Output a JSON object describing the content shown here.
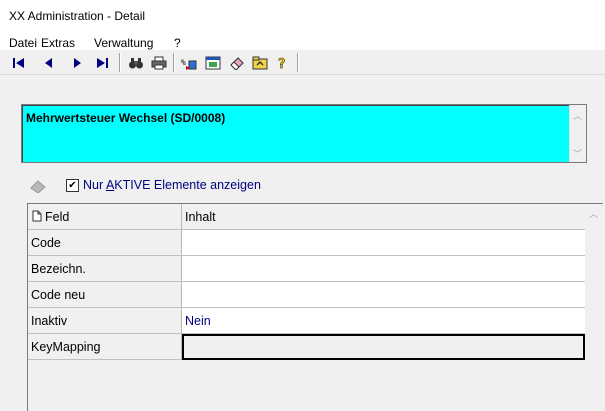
{
  "window": {
    "title": "XX Administration - Detail"
  },
  "menu": {
    "items": [
      "Datei",
      "Extras",
      "Verwaltung",
      "?"
    ]
  },
  "toolbar": {
    "buttons": [
      "first-record",
      "previous-record",
      "next-record",
      "last-record",
      "find",
      "print",
      "transfer",
      "export",
      "edit",
      "open-folder",
      "help"
    ]
  },
  "header": {
    "title": "Mehrwertsteuer Wechsel (SD/0008)"
  },
  "filter": {
    "checked": "☑",
    "label_prefix": "Nur ",
    "label_underlined": "A",
    "label_suffix": "KTIVE Elemente anzeigen"
  },
  "grid": {
    "col_field": "Feld",
    "col_content": "Inhalt",
    "rows": [
      {
        "field": "Code",
        "value": ""
      },
      {
        "field": "Bezeichn.",
        "value": ""
      },
      {
        "field": "Code neu",
        "value": ""
      },
      {
        "field": "Inaktiv",
        "value": "Nein"
      },
      {
        "field": "KeyMapping",
        "value": ""
      }
    ]
  },
  "colors": {
    "header_bg": "#00ffff",
    "link_blue": "#000080"
  }
}
